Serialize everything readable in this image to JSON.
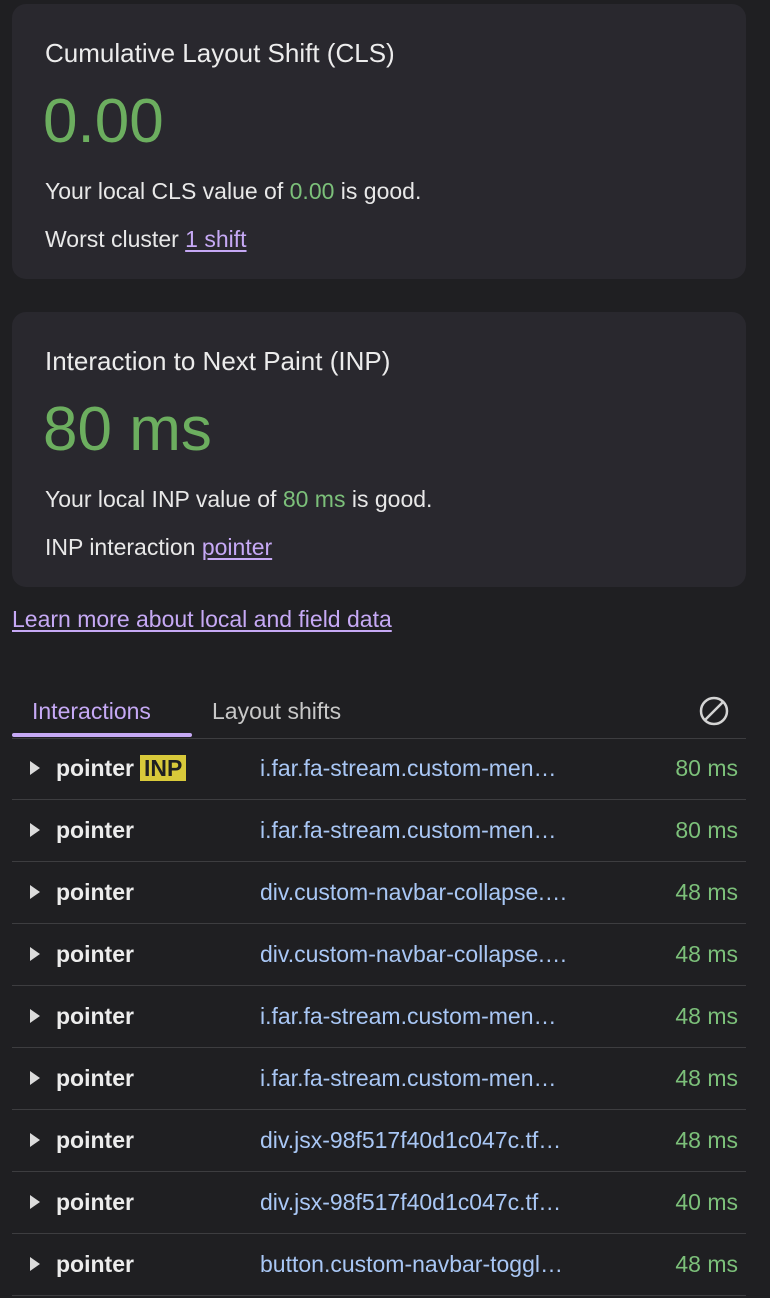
{
  "cls_card": {
    "title": "Cumulative Layout Shift (CLS)",
    "value": "0.00",
    "line1_prefix": "Your local CLS value of ",
    "line1_value": "0.00",
    "line1_suffix": " is good.",
    "line2_prefix": "Worst cluster ",
    "line2_link": "1 shift"
  },
  "inp_card": {
    "title": "Interaction to Next Paint (INP)",
    "value": "80 ms",
    "line1_prefix": "Your local INP value of ",
    "line1_value": "80 ms",
    "line1_suffix": " is good.",
    "line2_prefix": "INP interaction ",
    "line2_link": "pointer"
  },
  "learn_more": "Learn more about local and field data",
  "tabs": {
    "interactions": "Interactions",
    "layout_shifts": "Layout shifts"
  },
  "colors": {
    "good": "#7cc07a",
    "link": "#c6a9f5",
    "inp_badge": "#d8c93a"
  },
  "interactions": [
    {
      "type": "pointer",
      "badge": "INP",
      "target": "i.far.fa-stream.custom-men…",
      "duration": "80 ms"
    },
    {
      "type": "pointer",
      "badge": "",
      "target": "i.far.fa-stream.custom-men…",
      "duration": "80 ms"
    },
    {
      "type": "pointer",
      "badge": "",
      "target": "div.custom-navbar-collapse.…",
      "duration": "48 ms"
    },
    {
      "type": "pointer",
      "badge": "",
      "target": "div.custom-navbar-collapse.…",
      "duration": "48 ms"
    },
    {
      "type": "pointer",
      "badge": "",
      "target": "i.far.fa-stream.custom-men…",
      "duration": "48 ms"
    },
    {
      "type": "pointer",
      "badge": "",
      "target": "i.far.fa-stream.custom-men…",
      "duration": "48 ms"
    },
    {
      "type": "pointer",
      "badge": "",
      "target": "div.jsx-98f517f40d1c047c.tf…",
      "duration": "48 ms"
    },
    {
      "type": "pointer",
      "badge": "",
      "target": "div.jsx-98f517f40d1c047c.tf…",
      "duration": "40 ms"
    },
    {
      "type": "pointer",
      "badge": "",
      "target": "button.custom-navbar-toggl…",
      "duration": "48 ms"
    }
  ]
}
